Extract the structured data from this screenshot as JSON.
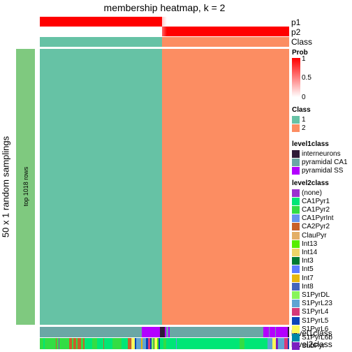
{
  "title": "membership heatmap, k = 2",
  "left_label": "50 x 1 random samplings",
  "bar_label": "top 1018 rows",
  "row_labels": {
    "p1": "p1",
    "p2": "p2",
    "class": "Class",
    "level1": "level1class",
    "level2": "level2class"
  },
  "chart_data": {
    "type": "heatmap",
    "title": "membership heatmap, k = 2",
    "class1_fraction": 0.49,
    "colors": {
      "class1": "#66C2A5",
      "class2": "#FC8D62",
      "prob_high": "#FF0000",
      "prob_low": "#FFFFFF",
      "left_bar": "#7FC97F"
    },
    "prob_legend": {
      "title": "Prob",
      "ticks": [
        "1",
        "0.5",
        "0"
      ]
    },
    "class_legend": {
      "title": "Class",
      "items": [
        {
          "label": "1",
          "color": "#66C2A5"
        },
        {
          "label": "2",
          "color": "#FC8D62"
        }
      ]
    },
    "level1_legend": {
      "title": "level1class",
      "items": [
        {
          "label": "interneurons",
          "color": "#2E1A38"
        },
        {
          "label": "pyramidal CA1",
          "color": "#6AA7A5"
        },
        {
          "label": "pyramidal SS",
          "color": "#B300FF"
        }
      ]
    },
    "level2_legend": {
      "title": "level2class",
      "items": [
        {
          "label": "(none)",
          "color": "#9B30D0"
        },
        {
          "label": "CA1Pyr1",
          "color": "#00E676"
        },
        {
          "label": "CA1Pyr2",
          "color": "#33DD44"
        },
        {
          "label": "CA1PyrInt",
          "color": "#6495ED"
        },
        {
          "label": "CA2Pyr2",
          "color": "#C8602A"
        },
        {
          "label": "ClauPyr",
          "color": "#E3AE66"
        },
        {
          "label": "Int13",
          "color": "#55EE00"
        },
        {
          "label": "Int14",
          "color": "#EDD568"
        },
        {
          "label": "Int3",
          "color": "#007A33"
        },
        {
          "label": "Int5",
          "color": "#5B7CFF"
        },
        {
          "label": "Int7",
          "color": "#E6B80F"
        },
        {
          "label": "Int8",
          "color": "#4466BB"
        },
        {
          "label": "S1PyrDL",
          "color": "#88F55A"
        },
        {
          "label": "S1PyrL23",
          "color": "#5FA5D3"
        },
        {
          "label": "S1PyrL4",
          "color": "#D83A78"
        },
        {
          "label": "S1PyrL5",
          "color": "#0D46B8"
        },
        {
          "label": "S1PyrL6",
          "color": "#FAFA5A"
        },
        {
          "label": "S1PyrL6b",
          "color": "#0088A8"
        },
        {
          "label": "SubPyr",
          "color": "#7A1FC0"
        }
      ]
    },
    "level1_segments": [
      [
        "pyramidal CA1",
        148
      ],
      [
        "pyramidal SS",
        26
      ],
      [
        "interneurons",
        8
      ],
      [
        "pyramidal SS",
        2
      ],
      [
        "pyramidal CA1",
        3
      ],
      [
        "pyramidal SS",
        2
      ],
      [
        "pyramidal CA1",
        136
      ],
      [
        "pyramidal SS",
        8
      ],
      [
        "pyramidal CA1",
        1
      ],
      [
        "pyramidal SS",
        8
      ],
      [
        "pyramidal CA1",
        1
      ],
      [
        "pyramidal SS",
        17
      ],
      [
        "interneurons",
        2
      ]
    ],
    "level2_segments": [
      [
        "CA1Pyr2",
        4
      ],
      [
        "CA1Pyr1",
        2
      ],
      [
        "CA1Pyr2",
        14
      ],
      [
        "CA2Pyr2",
        1
      ],
      [
        "CA1Pyr2",
        3
      ],
      [
        "(none)",
        1
      ],
      [
        "CA1Pyr2",
        12
      ],
      [
        "CA2Pyr2",
        4
      ],
      [
        "CA1Pyr2",
        2
      ],
      [
        "CA2Pyr2",
        3
      ],
      [
        "CA1Pyr2",
        2
      ],
      [
        "CA2Pyr2",
        4
      ],
      [
        "CA1Pyr2",
        3
      ],
      [
        "CA2Pyr2",
        2
      ],
      [
        "CA1Pyr1",
        10
      ],
      [
        "CA1Pyr2",
        6
      ],
      [
        "CA1Pyr1",
        8
      ],
      [
        "CA2Pyr2",
        1
      ],
      [
        "CA1Pyr1",
        10
      ],
      [
        "CA1Pyr2",
        12
      ],
      [
        "CA1Pyr1",
        8
      ],
      [
        "CA2Pyr2",
        4
      ],
      [
        "Int14",
        1
      ],
      [
        "S1PyrL6",
        4
      ],
      [
        "S1PyrL5",
        2
      ],
      [
        "S1PyrL23",
        6
      ],
      [
        "Int7",
        2
      ],
      [
        "S1PyrL23",
        4
      ],
      [
        "S1PyrL5",
        3
      ],
      [
        "S1PyrL4",
        2
      ],
      [
        "S1PyrL5",
        2
      ],
      [
        "S1PyrDL",
        3
      ],
      [
        "Int3",
        1
      ],
      [
        "S1PyrL6",
        3
      ],
      [
        "Int13",
        2
      ],
      [
        "S1PyrL5",
        2
      ],
      [
        "CA1Pyr1",
        4
      ],
      [
        "CA1Pyr2",
        4
      ],
      [
        "CA1Pyr1",
        12
      ],
      [
        "CA1PyrInt",
        1
      ],
      [
        "CA1Pyr1",
        80
      ],
      [
        "CA1Pyr2",
        6
      ],
      [
        "CA1Pyr1",
        30
      ],
      [
        "S1PyrL23",
        6
      ],
      [
        "S1PyrL6",
        4
      ],
      [
        "SubPyr",
        3
      ],
      [
        "S1PyrL23",
        8
      ],
      [
        "S1PyrL4",
        4
      ],
      [
        "S1PyrL5",
        2
      ]
    ]
  }
}
